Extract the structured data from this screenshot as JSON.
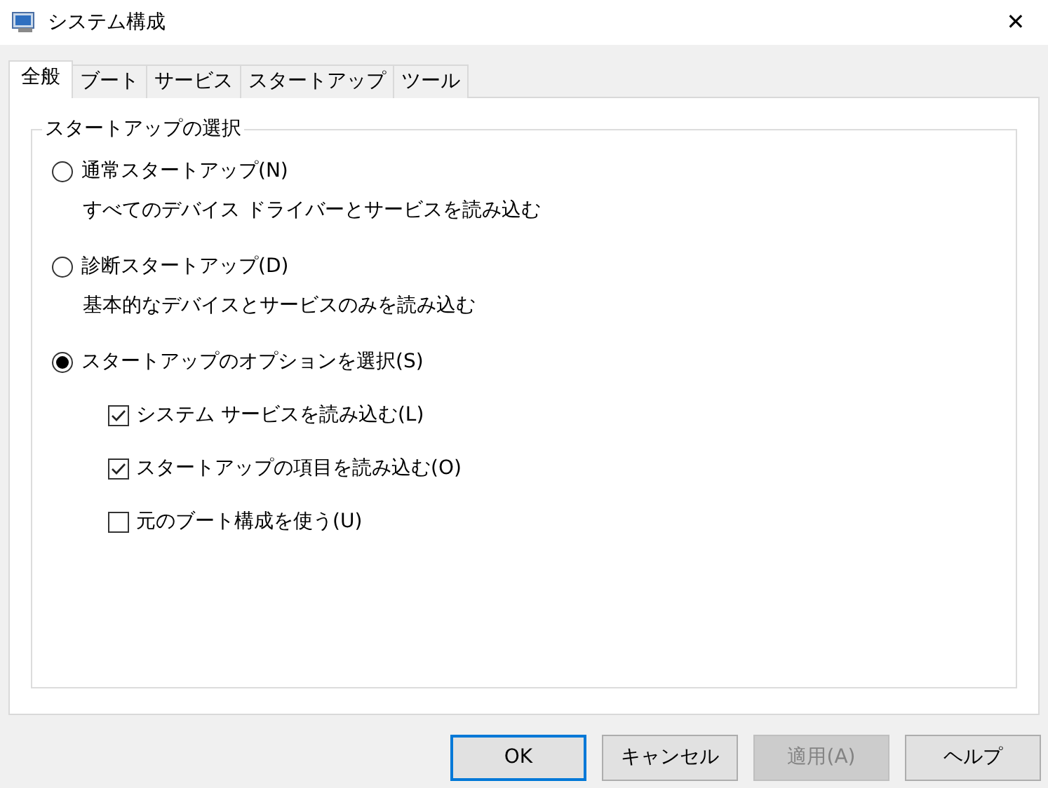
{
  "window": {
    "title": "システム構成",
    "close": "✕"
  },
  "tabs": [
    {
      "label": "全般",
      "selected": true
    },
    {
      "label": "ブート",
      "selected": false
    },
    {
      "label": "サービス",
      "selected": false
    },
    {
      "label": "スタートアップ",
      "selected": false
    },
    {
      "label": "ツール",
      "selected": false
    }
  ],
  "group": {
    "title": "スタートアップの選択",
    "options": [
      {
        "label": "通常スタートアップ(N)",
        "description": "すべてのデバイス ドライバーとサービスを読み込む",
        "selected": false
      },
      {
        "label": "診断スタートアップ(D)",
        "description": "基本的なデバイスとサービスのみを読み込む",
        "selected": false
      },
      {
        "label": "スタートアップのオプションを選択(S)",
        "selected": true,
        "checkboxes": [
          {
            "label": "システム サービスを読み込む(L)",
            "checked": true
          },
          {
            "label": "スタートアップの項目を読み込む(O)",
            "checked": true
          },
          {
            "label": "元のブート構成を使う(U)",
            "checked": false
          }
        ]
      }
    ]
  },
  "buttons": [
    {
      "label": "OK",
      "default": true,
      "disabled": false
    },
    {
      "label": "キャンセル",
      "default": false,
      "disabled": false
    },
    {
      "label": "適用(A)",
      "default": false,
      "disabled": true
    },
    {
      "label": "ヘルプ",
      "default": false,
      "disabled": false
    }
  ]
}
